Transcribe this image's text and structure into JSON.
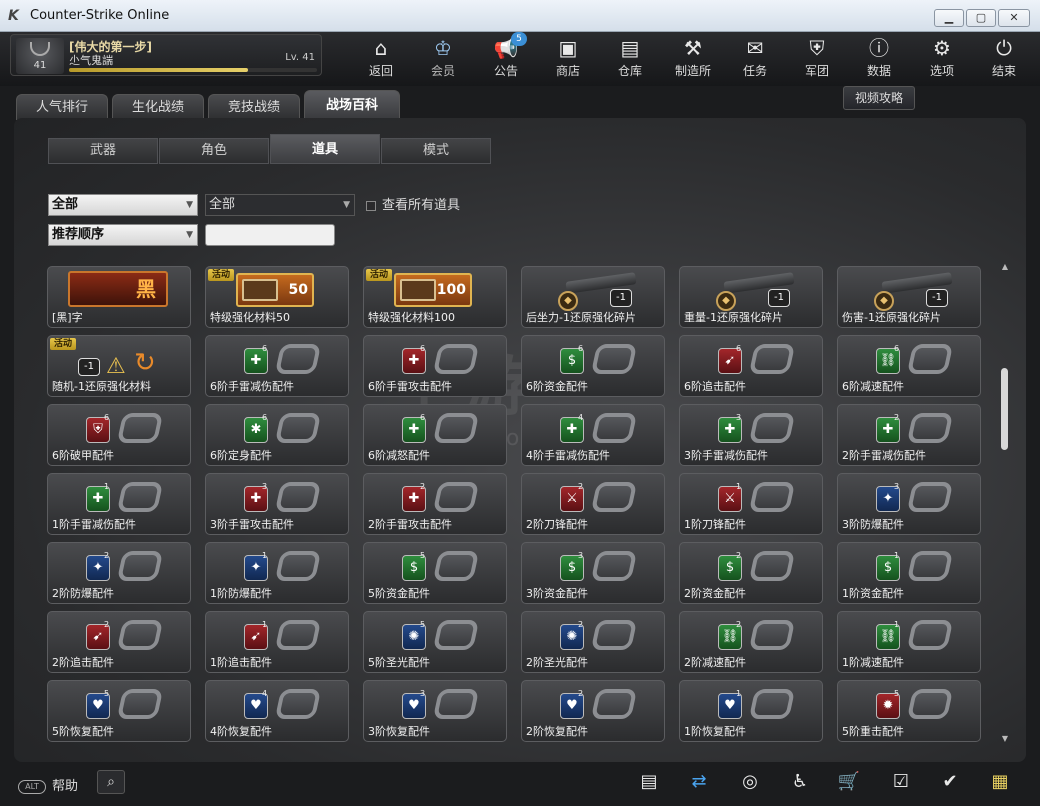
{
  "window": {
    "title": "Counter-Strike Online",
    "min": "▁",
    "max": "▢",
    "close": "✕"
  },
  "profile": {
    "name": "[伟大的第一步]",
    "title": "尐气鬼諯",
    "level_label": "Lv. 41",
    "avatar_level": "41",
    "xp_fraction": 0.72
  },
  "nav": [
    {
      "label": "返回",
      "icon": "home-icon",
      "glyph": "⌂"
    },
    {
      "label": "会员",
      "icon": "crown-icon",
      "glyph": "♔"
    },
    {
      "label": "公告",
      "icon": "megaphone-icon",
      "glyph": "📢",
      "badge": "5"
    },
    {
      "label": "商店",
      "icon": "shop-icon",
      "glyph": "▣"
    },
    {
      "label": "仓库",
      "icon": "briefcase-icon",
      "glyph": "▤"
    },
    {
      "label": "制造所",
      "icon": "forge-icon",
      "glyph": "⚒"
    },
    {
      "label": "任务",
      "icon": "mission-icon",
      "glyph": "✉"
    },
    {
      "label": "军团",
      "icon": "clan-shield-icon",
      "glyph": "⛨"
    },
    {
      "label": "数据",
      "icon": "info-icon",
      "glyph": "ⓘ"
    },
    {
      "label": "选项",
      "icon": "gear-icon",
      "glyph": "⚙"
    },
    {
      "label": "结束",
      "icon": "power-icon",
      "glyph": "⏻"
    }
  ],
  "main_tabs": [
    "人气排行",
    "生化战绩",
    "竞技战绩",
    "战场百科"
  ],
  "video_button": "视频攻略",
  "sub_tabs": [
    "武器",
    "角色",
    "道具",
    "模式"
  ],
  "filters": {
    "category": "全部",
    "subcategory": "全部",
    "sort": "推荐顺序",
    "search_value": "",
    "show_all_label": "查看所有道具"
  },
  "tags": {
    "event": "活动"
  },
  "special": {
    "hei_char": "黑",
    "box50": "50",
    "box100": "100",
    "minus1": "-1"
  },
  "items": [
    "[黑]字",
    "特级强化材料50",
    "特级强化材料100",
    "后坐力-1还原强化碎片",
    "重量-1还原强化碎片",
    "伤害-1还原强化碎片",
    "随机-1还原强化材料",
    "6阶手雷减伤配件",
    "6阶手雷攻击配件",
    "6阶资金配件",
    "6阶追击配件",
    "6阶减速配件",
    "6阶破甲配件",
    "6阶定身配件",
    "6阶减怒配件",
    "4阶手雷减伤配件",
    "3阶手雷减伤配件",
    "2阶手雷减伤配件",
    "1阶手雷减伤配件",
    "3阶手雷攻击配件",
    "2阶手雷攻击配件",
    "2阶刀锋配件",
    "1阶刀锋配件",
    "3阶防爆配件",
    "2阶防爆配件",
    "1阶防爆配件",
    "5阶资金配件",
    "3阶资金配件",
    "2阶资金配件",
    "1阶资金配件",
    "2阶追击配件",
    "1阶追击配件",
    "5阶圣光配件",
    "2阶圣光配件",
    "2阶减速配件",
    "1阶减速配件",
    "5阶恢复配件",
    "4阶恢复配件",
    "3阶恢复配件",
    "2阶恢复配件",
    "1阶恢复配件",
    "5阶重击配件"
  ],
  "watermark": {
    "big": "手游",
    "small": "shouyou.com"
  },
  "bottom": {
    "help_pill": "ALT",
    "help_label": "帮助",
    "icons": [
      "news-icon",
      "exchange-icon",
      "compass-icon",
      "runner-icon",
      "cart-icon",
      "checklist-icon",
      "calendar-check-icon",
      "film-icon"
    ]
  }
}
